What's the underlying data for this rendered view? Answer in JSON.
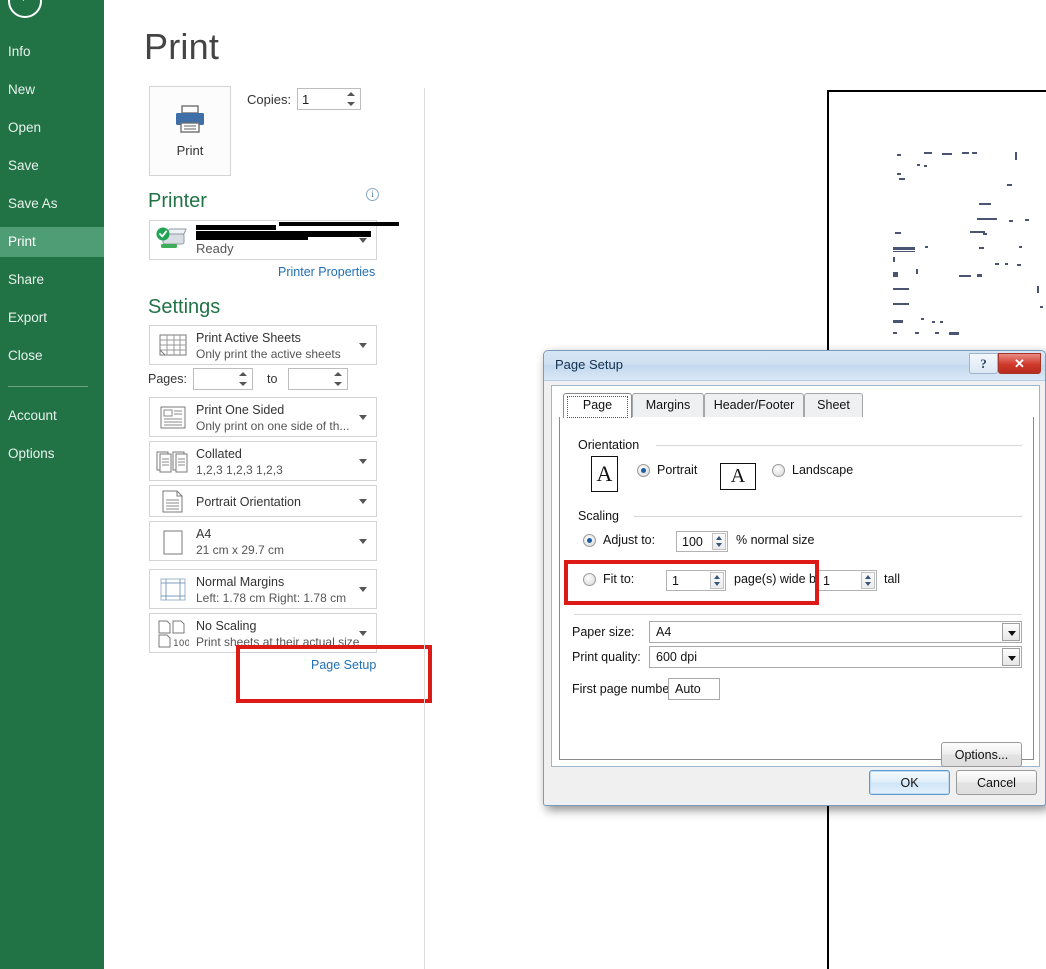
{
  "sidebar": {
    "back_icon": "back-arrow-icon",
    "items": [
      {
        "label": "Info",
        "active": false
      },
      {
        "label": "New",
        "active": false
      },
      {
        "label": "Open",
        "active": false
      },
      {
        "label": "Save",
        "active": false
      },
      {
        "label": "Save As",
        "active": false
      },
      {
        "label": "Print",
        "active": true
      },
      {
        "label": "Share",
        "active": false
      },
      {
        "label": "Export",
        "active": false
      },
      {
        "label": "Close",
        "active": false
      }
    ],
    "bottom_items": [
      {
        "label": "Account"
      },
      {
        "label": "Options"
      }
    ],
    "accent_color": "#217346",
    "active_color": "#4e9d74"
  },
  "print_pane": {
    "title": "Print",
    "print_button_label": "Print",
    "copies_label": "Copies:",
    "copies_value": "1",
    "printer_heading": "Printer",
    "printer_status": "Ready",
    "printer_properties_link": "Printer Properties",
    "settings_heading": "Settings",
    "pages_label": "Pages:",
    "pages_from": "",
    "pages_to_label": "to",
    "pages_to": "",
    "page_setup_link": "Page Setup",
    "link_color": "#1f6fb4",
    "highlight_color": "#dd1b16",
    "settings": [
      {
        "icon": "worksheet-icon",
        "title": "Print Active Sheets",
        "subtitle": "Only print the active sheets"
      },
      {
        "icon": "one-sided-icon",
        "title": "Print One Sided",
        "subtitle": "Only print on one side of th..."
      },
      {
        "icon": "collate-icon",
        "title": "Collated",
        "subtitle": "1,2,3   1,2,3   1,2,3"
      },
      {
        "icon": "portrait-icon",
        "title": "Portrait Orientation",
        "subtitle": ""
      },
      {
        "icon": "paper-icon",
        "title": "A4",
        "subtitle": "21 cm x 29.7 cm"
      },
      {
        "icon": "margins-icon",
        "title": "Normal Margins",
        "subtitle": "Left:  1.78 cm    Right:  1.78 cm"
      },
      {
        "icon": "scaling-icon",
        "title": "No Scaling",
        "subtitle": "Print sheets at their actual size"
      }
    ]
  },
  "dialog": {
    "title": "Page Setup",
    "help_label": "?",
    "close_label": "✕",
    "tabs": [
      {
        "label": "Page",
        "active": true
      },
      {
        "label": "Margins",
        "active": false
      },
      {
        "label": "Header/Footer",
        "active": false
      },
      {
        "label": "Sheet",
        "active": false
      }
    ],
    "orientation": {
      "group_label": "Orientation",
      "portrait_label": "Portrait",
      "portrait_selected": true,
      "landscape_label": "Landscape",
      "landscape_selected": false,
      "glyph": "A"
    },
    "scaling": {
      "group_label": "Scaling",
      "adjust_label": "Adjust to:",
      "adjust_selected": true,
      "adjust_value": "100",
      "adjust_suffix": "% normal size",
      "fit_label": "Fit to:",
      "fit_selected": false,
      "fit_wide_value": "1",
      "fit_mid_text": "page(s) wide by",
      "fit_tall_value": "1",
      "fit_suffix": "tall"
    },
    "paper_size_label": "Paper size:",
    "paper_size_value": "A4",
    "print_quality_label": "Print quality:",
    "print_quality_value": "600 dpi",
    "first_page_label": "First page number:",
    "first_page_value": "Auto",
    "options_button": "Options...",
    "ok_button": "OK",
    "cancel_button": "Cancel"
  }
}
